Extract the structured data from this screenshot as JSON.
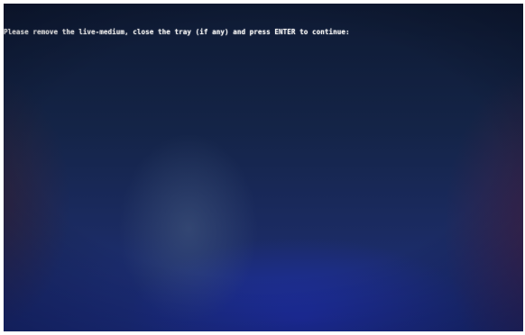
{
  "console": {
    "message": "Please remove the live-medium, close the tray (if any) and press ENTER to continue:"
  }
}
